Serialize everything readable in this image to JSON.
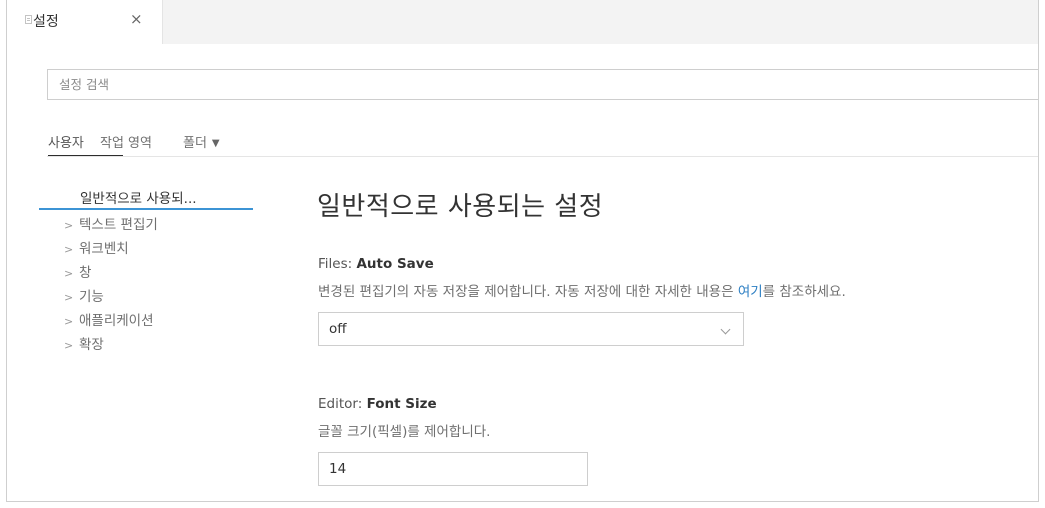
{
  "tab": {
    "title": "설정",
    "close": "×",
    "icon": "file-icon"
  },
  "search": {
    "placeholder": "설정 검색",
    "value": ""
  },
  "scope_tabs": [
    {
      "label": "사용자",
      "active": true
    },
    {
      "label": "작업 영역",
      "active": false
    },
    {
      "label": "폴더",
      "active": false,
      "dropdown": true
    }
  ],
  "toc": {
    "active_label": "일반적으로 사용되...",
    "items": [
      {
        "label": "텍스트 편집기",
        "icon": "chevron-right-icon"
      },
      {
        "label": "워크벤치",
        "icon": "chevron-right-icon"
      },
      {
        "label": "창",
        "icon": "chevron-right-icon"
      },
      {
        "label": "기능",
        "icon": "chevron-right-icon"
      },
      {
        "label": "애플리케이션",
        "icon": "chevron-right-icon"
      },
      {
        "label": "확장",
        "icon": "chevron-right-icon"
      }
    ]
  },
  "main": {
    "heading": "일반적으로 사용되는 설정",
    "settings": [
      {
        "category": "Files: ",
        "name": "Auto Save",
        "description_before": "변경된 편집기의 자동 저장을 제어합니다. 자동 저장에 대한 자세한 내용은 ",
        "description_link": "여기",
        "description_after": "를 참조하세요.",
        "control": "select",
        "value": "off"
      },
      {
        "category": "Editor: ",
        "name": "Font Size",
        "description": "글꼴 크기(픽셀)를 제어합니다.",
        "control": "number",
        "value": "14"
      }
    ]
  },
  "colors": {
    "accent": "#3c94d5",
    "link": "#2d7fc3",
    "border": "#cecece"
  }
}
